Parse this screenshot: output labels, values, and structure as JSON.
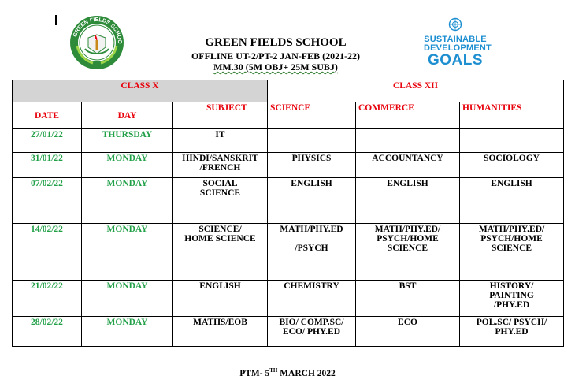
{
  "header": {
    "school": "GREEN FIELDS SCHOOL",
    "exam": "OFFLINE UT-2/PT-2 JAN-FEB (2021-22)",
    "marks": "MM.30 (5M OBJ+ 25M SUBJ)"
  },
  "logo": {
    "text": "GREEN FIELDS SCHOOL"
  },
  "sdg_logo": {
    "line1": "SUSTAINABLE",
    "line2": "DEVELOPMENT",
    "line3": "GOALS"
  },
  "table": {
    "class_x": "CLASS X",
    "class_xii": "CLASS XII",
    "columns": {
      "date": "DATE",
      "day": "DAY",
      "subject": "SUBJECT",
      "science": "SCIENCE",
      "commerce": "COMMERCE",
      "humanities": "HUMANITIES"
    },
    "rows": [
      {
        "date": "27/01/22",
        "day": "THURSDAY",
        "subject": "IT",
        "science": "",
        "commerce": "",
        "humanities": ""
      },
      {
        "date": "31/01/22",
        "day": "MONDAY",
        "subject": "HINDI/SANSKRIT\n/FRENCH",
        "science": "PHYSICS",
        "commerce": "ACCOUNTANCY",
        "humanities": "SOCIOLOGY"
      },
      {
        "date": "07/02/22",
        "day": "MONDAY",
        "subject": "SOCIAL\nSCIENCE",
        "science": "ENGLISH",
        "commerce": "ENGLISH",
        "humanities": "ENGLISH"
      },
      {
        "date": "14/02/22",
        "day": "MONDAY",
        "subject": "SCIENCE/\nHOME SCIENCE",
        "science": "MATH/PHY.ED\n\n/PSYCH",
        "commerce": "MATH/PHY.ED/\nPSYCH/HOME\nSCIENCE",
        "humanities": "MATH/PHY.ED/\nPSYCH/HOME\nSCIENCE"
      },
      {
        "date": "21/02/22",
        "day": "MONDAY",
        "subject": "ENGLISH",
        "science": "CHEMISTRY",
        "commerce": "BST",
        "humanities": "HISTORY/\nPAINTING\n/PHY.ED"
      },
      {
        "date": "28/02/22",
        "day": "MONDAY",
        "subject": "MATHS/EOB",
        "science": "BIO/ COMP.SC/\nECO/ PHY.ED",
        "commerce": "ECO",
        "humanities": "POL.SC/ PSYCH/\nPHY.ED"
      }
    ]
  },
  "footer": {
    "ptm_prefix": "PTM- 5",
    "ptm_sup": "TH",
    "ptm_suffix": " MARCH 2022"
  },
  "colors": {
    "red": "#e8000b",
    "green": "#21a048",
    "sdg_blue": "#1d8fd1",
    "gray": "#d4d4d4"
  }
}
